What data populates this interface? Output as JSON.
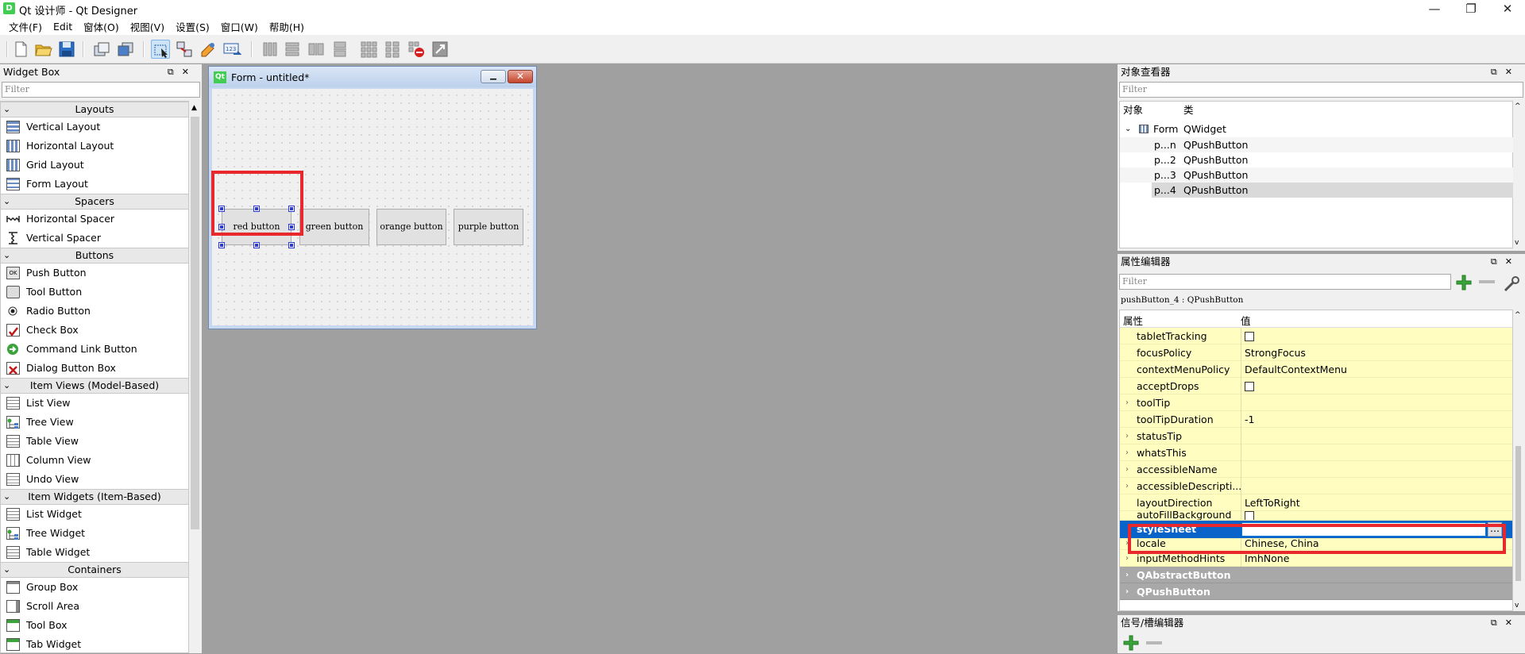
{
  "window": {
    "title": "Qt 设计师 - Qt Designer",
    "icon": "D",
    "minimize": "—",
    "maximize": "❐",
    "close": "✕"
  },
  "menubar": [
    "文件(F)",
    "Edit",
    "窗体(O)",
    "视图(V)",
    "设置(S)",
    "窗口(W)",
    "帮助(H)"
  ],
  "widget_box": {
    "title": "Widget Box",
    "filter_placeholder": "Filter",
    "categories": [
      {
        "name": "Layouts",
        "items": [
          "Vertical Layout",
          "Horizontal Layout",
          "Grid Layout",
          "Form Layout"
        ]
      },
      {
        "name": "Spacers",
        "items": [
          "Horizontal Spacer",
          "Vertical Spacer"
        ]
      },
      {
        "name": "Buttons",
        "items": [
          "Push Button",
          "Tool Button",
          "Radio Button",
          "Check Box",
          "Command Link Button",
          "Dialog Button Box"
        ]
      },
      {
        "name": "Item Views (Model-Based)",
        "items": [
          "List View",
          "Tree View",
          "Table View",
          "Column View",
          "Undo View"
        ]
      },
      {
        "name": "Item Widgets (Item-Based)",
        "items": [
          "List Widget",
          "Tree Widget",
          "Table Widget"
        ]
      },
      {
        "name": "Containers",
        "items": [
          "Group Box",
          "Scroll Area",
          "Tool Box",
          "Tab Widget"
        ]
      }
    ]
  },
  "form": {
    "title": "Form - untitled*",
    "icon": "Qt",
    "buttons": [
      "red button",
      "green button",
      "orange button",
      "purple button"
    ]
  },
  "object_inspector": {
    "title": "对象查看器",
    "filter_placeholder": "Filter",
    "col_object": "对象",
    "col_class": "类",
    "root": {
      "name": "Form",
      "class": "QWidget"
    },
    "children": [
      {
        "name": "p...n",
        "class": "QPushButton"
      },
      {
        "name": "p...2",
        "class": "QPushButton"
      },
      {
        "name": "p...3",
        "class": "QPushButton"
      },
      {
        "name": "p...4",
        "class": "QPushButton"
      }
    ]
  },
  "property_editor": {
    "title": "属性编辑器",
    "filter_placeholder": "Filter",
    "object_label": "pushButton_4 : QPushButton",
    "col_property": "属性",
    "col_value": "值",
    "rows": [
      {
        "name": "tabletTracking",
        "value": ""
      },
      {
        "name": "focusPolicy",
        "value": "StrongFocus"
      },
      {
        "name": "contextMenuPolicy",
        "value": "DefaultContextMenu"
      },
      {
        "name": "acceptDrops",
        "value": ""
      },
      {
        "name": "toolTip",
        "value": ""
      },
      {
        "name": "toolTipDuration",
        "value": "-1"
      },
      {
        "name": "statusTip",
        "value": ""
      },
      {
        "name": "whatsThis",
        "value": ""
      },
      {
        "name": "accessibleName",
        "value": ""
      },
      {
        "name": "accessibleDescripti...",
        "value": ""
      },
      {
        "name": "layoutDirection",
        "value": "LeftToRight"
      },
      {
        "name": "autoFillBackground",
        "value": ""
      },
      {
        "name": "styleSheet",
        "value": ""
      },
      {
        "name": "locale",
        "value": "Chinese, China"
      },
      {
        "name": "inputMethodHints",
        "value": "ImhNone"
      }
    ],
    "groups": [
      "QAbstractButton",
      "QPushButton"
    ],
    "stylesheet_btn": "..."
  },
  "signal_slot_editor": {
    "title": "信号/槽编辑器"
  },
  "colors": {
    "highlight": "#e8282d",
    "selection": "#0078d7",
    "form_bg": "#f0f0f0",
    "property_row": "#fffec0"
  }
}
